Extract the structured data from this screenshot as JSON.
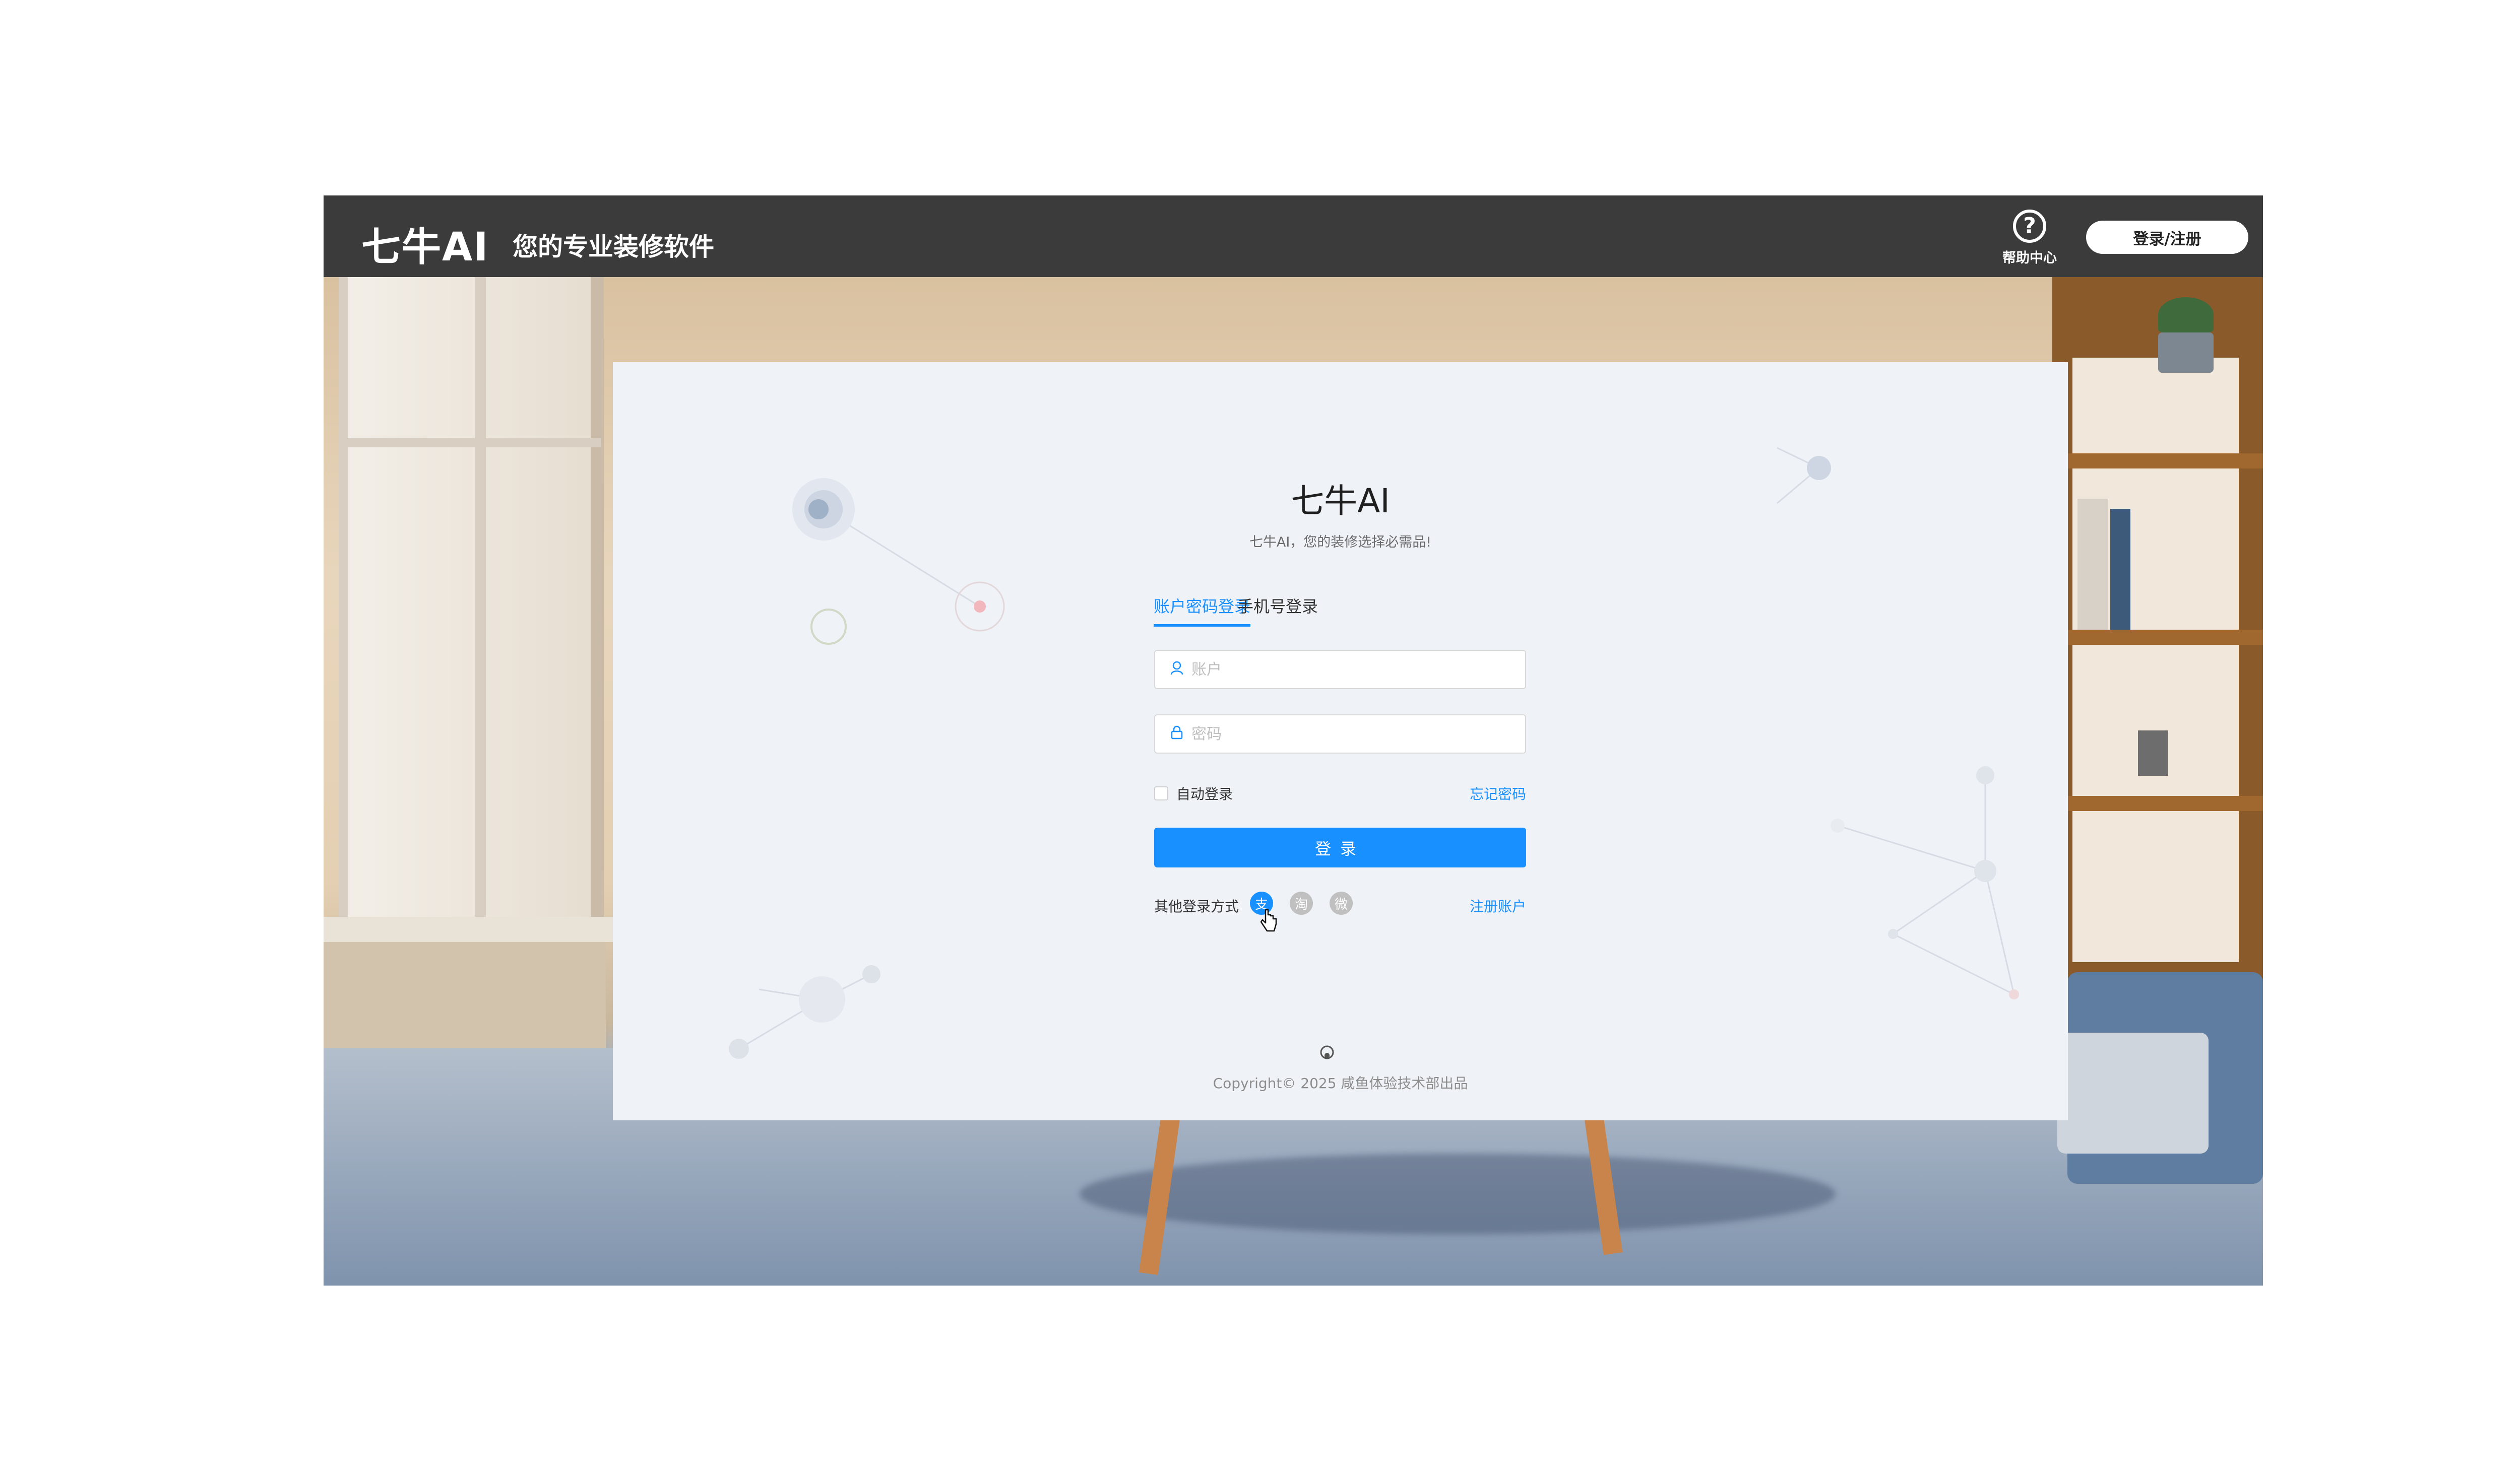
{
  "header": {
    "logo": "七牛AI",
    "slogan": "您的专业装修软件",
    "help_label": "帮助中心",
    "help_icon": "?",
    "login_register_label": "登录/注册"
  },
  "login": {
    "title": "七牛AI",
    "subtitle": "七牛AI，您的装修选择必需品!",
    "tabs": [
      {
        "label": "账户密码登录",
        "active": true
      },
      {
        "label": "手机号登录",
        "active": false
      }
    ],
    "account_placeholder": "账户",
    "password_placeholder": "密码",
    "auto_login_label": "自动登录",
    "forgot_label": "忘记密码",
    "submit_label": "登录",
    "other_methods_label": "其他登录方式",
    "social": [
      {
        "name": "alipay-icon",
        "glyph": "支"
      },
      {
        "name": "taobao-icon",
        "glyph": "淘"
      },
      {
        "name": "weibo-icon",
        "glyph": "微"
      }
    ],
    "register_label": "注册账户"
  },
  "footer": {
    "copyright": "Copyright© 2025 咸鱼体验技术部出品"
  },
  "colors": {
    "primary": "#1890ff",
    "topbar": "#3b3b3b",
    "card_bg": "#eff2f7"
  }
}
